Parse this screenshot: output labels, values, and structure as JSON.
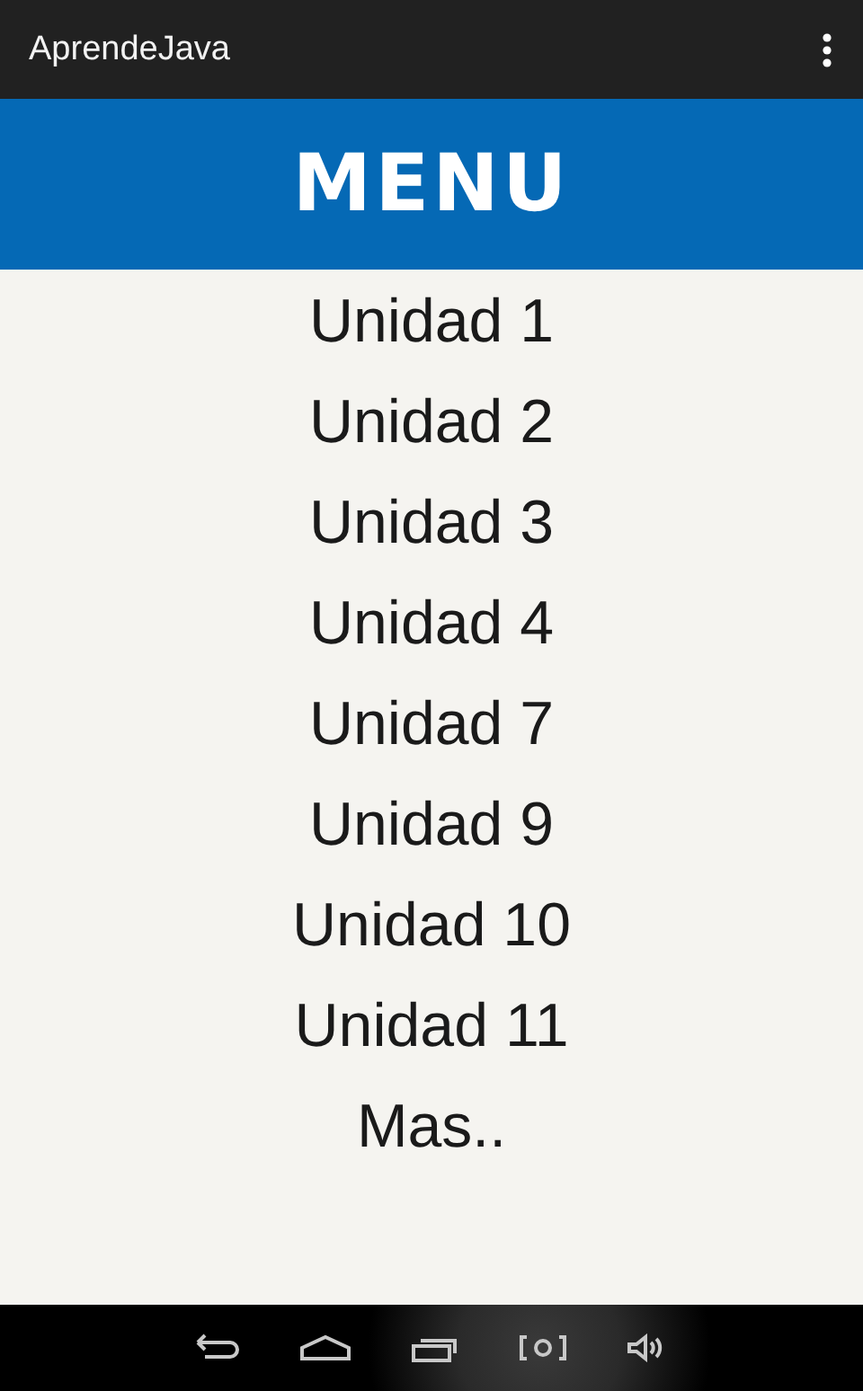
{
  "action_bar": {
    "title": "AprendeJava"
  },
  "header": {
    "title": "MENU"
  },
  "menu_items": [
    "Unidad 1",
    "Unidad 2",
    "Unidad 3",
    "Unidad 4",
    "Unidad 7",
    "Unidad 9",
    "Unidad 10",
    "Unidad 11",
    "Mas.."
  ]
}
